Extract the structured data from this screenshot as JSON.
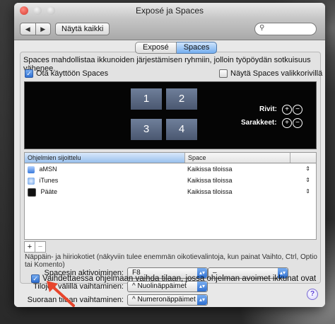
{
  "window": {
    "title": "Exposé ja Spaces"
  },
  "toolbar": {
    "show_all": "Näytä kaikki",
    "search_placeholder": ""
  },
  "tabs": [
    {
      "label": "Exposé"
    },
    {
      "label": "Spaces"
    }
  ],
  "content": {
    "description": "Spaces mahdollistaa ikkunoiden järjestämisen ryhmiin, jolloin työpöydän sotkuisuus vähenee.",
    "enable_spaces": {
      "label": "Ota käyttöön Spaces",
      "checked": true
    },
    "show_in_menubar": {
      "label": "Näytä Spaces valikkorivillä",
      "checked": false
    }
  },
  "spaces_grid": {
    "numbers": [
      "1",
      "2",
      "3",
      "4"
    ],
    "rows_label": "Rivit:",
    "columns_label": "Sarakkeet:"
  },
  "table": {
    "columns": [
      "Ohjelmien sijoittelu",
      "Space"
    ],
    "rows": [
      {
        "app": "aMSN",
        "space": "Kaikissa tiloissa",
        "icon": "amsn-icon"
      },
      {
        "app": "iTunes",
        "space": "Kaikissa tiloissa",
        "icon": "itunes-icon"
      },
      {
        "app": "Pääte",
        "space": "Kaikissa tiloissa",
        "icon": "terminal-icon"
      }
    ],
    "add": "+",
    "remove": "−"
  },
  "shortcuts": {
    "section_title": "Näppäin- ja hiiriokotiet (näkyviin tulee enemmän oikotievalintoja, kun painat Vaihto, Ctrl, Optio tai Komento)",
    "activate_label": "Spacesin aktivoiminen:",
    "activate_key": "F8",
    "activate_mouse": "–",
    "switch_between_label": "Tilojen välillä vaihtaminen:",
    "switch_between_value": "^ Nuolinäppäimet",
    "switch_direct_label": "Suoraan tilaan vaihtaminen:",
    "switch_direct_value": "^ Numeronäppäimet"
  },
  "bottom_checkbox": {
    "label": "Vaihdettaessa ohjelmaan vaihda tilaan, jossa ohjelman avoimet ikkunat ovat",
    "checked": true
  },
  "help_label": "?",
  "colors": {
    "accent": "#3a7bdc",
    "annotation_arrow": "#e8452c",
    "preview_bg": "#050505"
  }
}
